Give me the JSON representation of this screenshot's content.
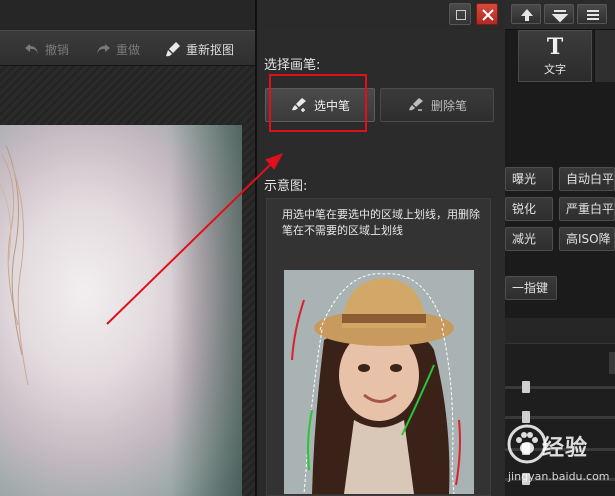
{
  "toolbar": {
    "undo_label": "撤销",
    "redo_label": "重做",
    "reset_label": "重新抠图"
  },
  "panel": {
    "brush_heading": "选择画笔:",
    "select_brush_label": "选中笔",
    "delete_brush_label": "删除笔",
    "preview_heading": "示意图:",
    "preview_description": "用选中笔在要选中的区域上划线，用删除笔在不需要的区域上划线"
  },
  "right_panel": {
    "text_tool_label": "文字",
    "buttons": [
      "曝光",
      "自动白平",
      "锐化",
      "严重白平",
      "减光",
      "高ISO降",
      "一指键"
    ]
  },
  "watermark": {
    "logo_text": "经验",
    "url": "jingyan.baidu.com"
  },
  "colors": {
    "annotation_red": "#e0101a",
    "close_button": "#c0392b",
    "panel_bg": "#2b2b2b"
  }
}
